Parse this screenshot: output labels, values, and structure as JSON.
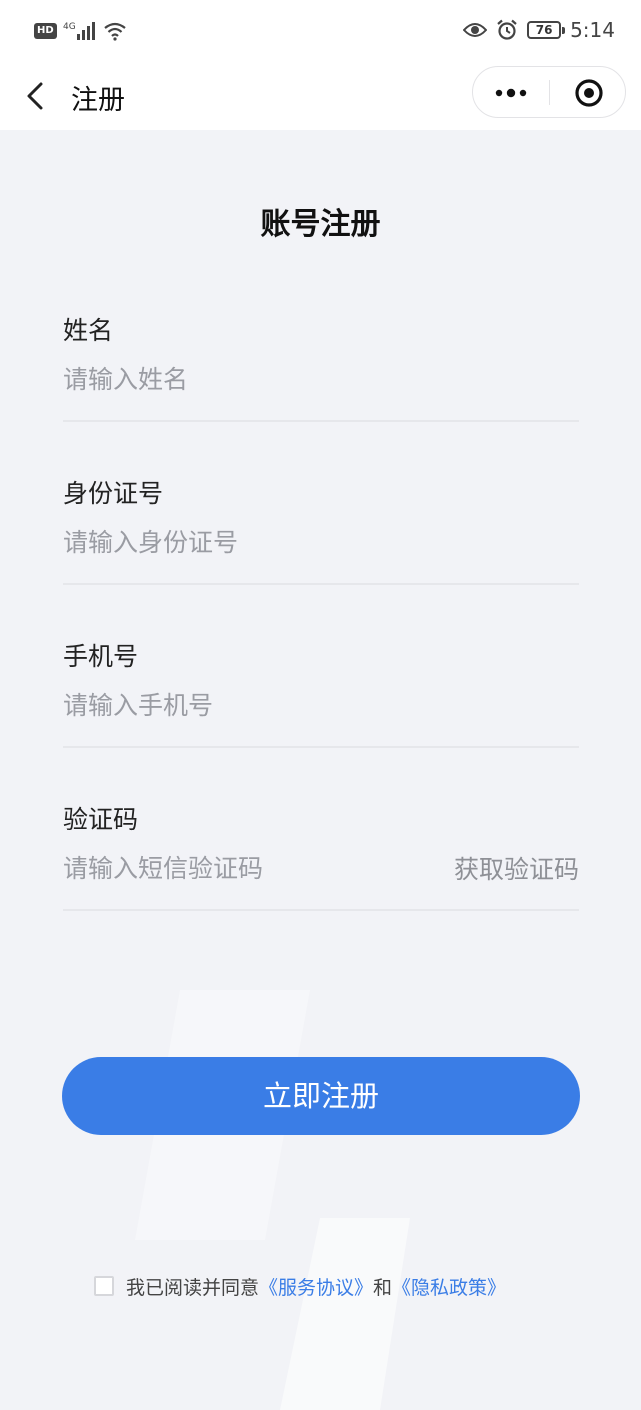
{
  "status_bar": {
    "network_badge": "HD",
    "network_type": "4G",
    "battery_level": "76",
    "time": "5:14"
  },
  "nav": {
    "title": "注册"
  },
  "page": {
    "heading": "账号注册"
  },
  "form": {
    "name": {
      "label": "姓名",
      "placeholder": "请输入姓名",
      "value": ""
    },
    "id_number": {
      "label": "身份证号",
      "placeholder": "请输入身份证号",
      "value": ""
    },
    "phone": {
      "label": "手机号",
      "placeholder": "请输入手机号",
      "value": ""
    },
    "code": {
      "label": "验证码",
      "placeholder": "请输入短信验证码",
      "value": "",
      "get_code_label": "获取验证码"
    }
  },
  "submit": {
    "label": "立即注册"
  },
  "agreement": {
    "checked": false,
    "prefix": "我已阅读并同意",
    "service_link": "《服务协议》",
    "conjunction": "和",
    "privacy_link": "《隐私政策》"
  },
  "colors": {
    "accent": "#3a7de6",
    "background": "#f2f3f7",
    "placeholder": "#9a9ca3"
  },
  "icons": [
    "back-arrow-icon",
    "more-dots-icon",
    "close-target-icon",
    "eye-icon",
    "alarm-icon",
    "signal-icon",
    "wifi-icon",
    "battery-icon"
  ]
}
